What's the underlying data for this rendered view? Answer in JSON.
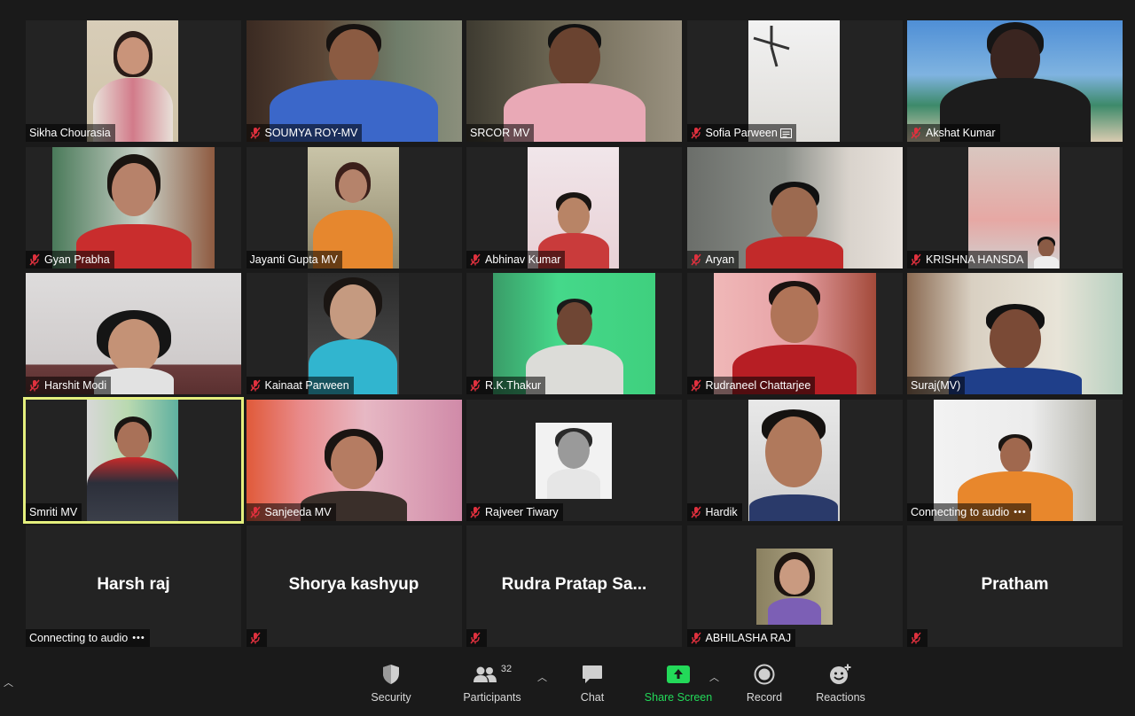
{
  "participants": [
    {
      "name": "Sikha Chourasia",
      "muted": false
    },
    {
      "name": "SOUMYA ROY-MV",
      "muted": true
    },
    {
      "name": "SRCOR MV",
      "muted": false
    },
    {
      "name": "Sofia  Parween",
      "muted": true,
      "extra_icon": "captions-icon"
    },
    {
      "name": "Akshat Kumar",
      "muted": true
    },
    {
      "name": "Gyan Prabha",
      "muted": true
    },
    {
      "name": "Jayanti Gupta MV",
      "muted": false
    },
    {
      "name": "Abhinav Kumar",
      "muted": true
    },
    {
      "name": "Aryan",
      "muted": true
    },
    {
      "name": "KRISHNA HANSDA",
      "muted": true
    },
    {
      "name": "Harshit Modi",
      "muted": true
    },
    {
      "name": "Kainaat Parween",
      "muted": true
    },
    {
      "name": "R.K.Thakur",
      "muted": true
    },
    {
      "name": "Rudraneel Chattarjee",
      "muted": true
    },
    {
      "name": "Suraj(MV)",
      "muted": false
    },
    {
      "name": "Smriti MV",
      "muted": false,
      "active_speaker": true
    },
    {
      "name": "Sanjeeda MV",
      "muted": true
    },
    {
      "name": "Rajveer Tiwary",
      "muted": true
    },
    {
      "name": "Hardik",
      "muted": true
    },
    {
      "name": "Connecting to audio",
      "muted": false,
      "connecting": true
    },
    {
      "name": "Harsh raj",
      "video_off": true,
      "status": "Connecting to audio"
    },
    {
      "name": "Shorya kashyup",
      "video_off": true,
      "muted": true
    },
    {
      "name": "Rudra  Pratap  Sa...",
      "video_off": true,
      "muted": true
    },
    {
      "name": "ABHILASHA RAJ",
      "muted": true,
      "profile_picture": true
    },
    {
      "name": "Pratham",
      "video_off": true,
      "muted": true
    }
  ],
  "toolbar": {
    "security": "Security",
    "participants": "Participants",
    "participant_count": "32",
    "chat": "Chat",
    "share_screen": "Share Screen",
    "record": "Record",
    "reactions": "Reactions",
    "share_color": "#23d959"
  },
  "colors": {
    "background": "#1a1a1a",
    "tile": "#232323",
    "active_speaker_border": "#e4ef7d",
    "muted_icon": "#e0313e"
  }
}
